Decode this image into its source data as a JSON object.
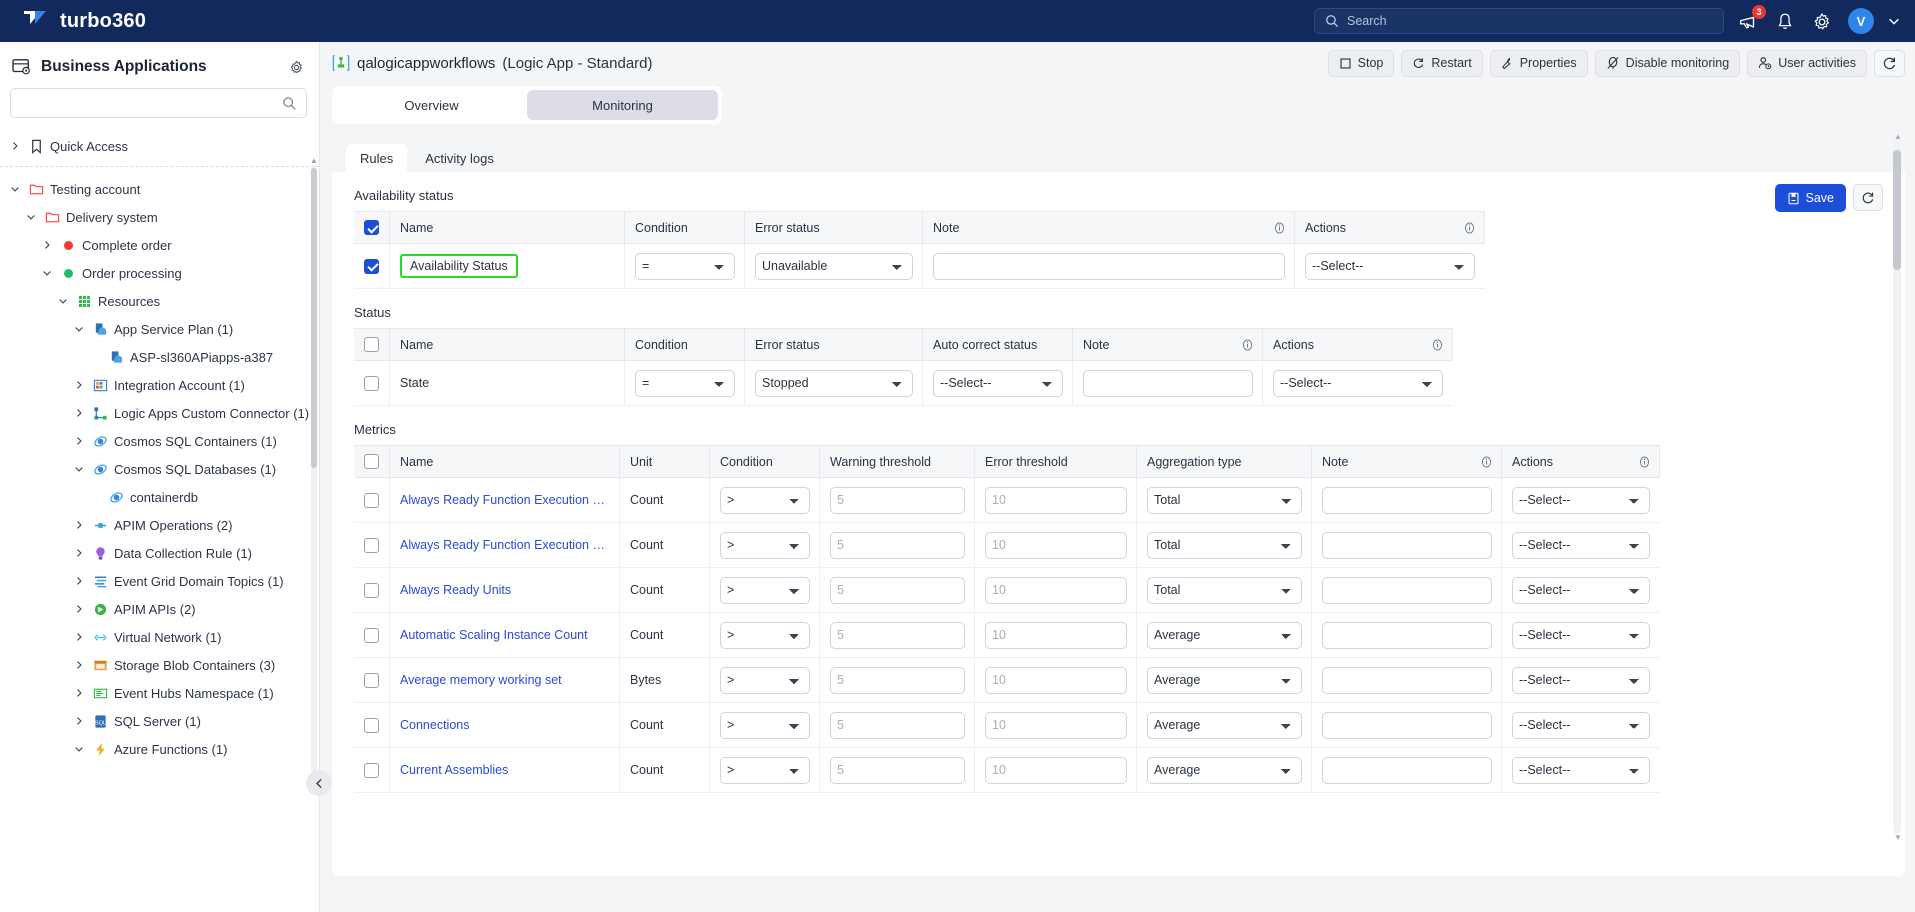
{
  "topbar": {
    "brand": "turbo360",
    "search_placeholder": "Search",
    "notification_badge": "3",
    "avatar_initial": "V",
    "icons": [
      "megaphone-icon",
      "bell-icon",
      "gear-icon",
      "chevron-down-icon"
    ]
  },
  "sidebar": {
    "title": "Business Applications",
    "search_placeholder": "",
    "tree": [
      {
        "label": "Quick Access",
        "indent": 0,
        "caret": "right",
        "icon": "bookmark"
      },
      {
        "label": "Testing account",
        "indent": 0,
        "caret": "down",
        "icon": "folder-red"
      },
      {
        "label": "Delivery system",
        "indent": 1,
        "caret": "down",
        "icon": "folder-red"
      },
      {
        "label": "Complete order",
        "indent": 2,
        "caret": "right",
        "icon": "dot-red"
      },
      {
        "label": "Order processing",
        "indent": 2,
        "caret": "down",
        "icon": "dot-green"
      },
      {
        "label": "Resources",
        "indent": 3,
        "caret": "down",
        "icon": "grid-green"
      },
      {
        "label": "App Service Plan (1)",
        "indent": 4,
        "caret": "down",
        "icon": "appservice"
      },
      {
        "label": "ASP-sl360APiapps-a387",
        "indent": 5,
        "caret": "none",
        "icon": "appservice"
      },
      {
        "label": "Integration Account (1)",
        "indent": 4,
        "caret": "right",
        "icon": "integration"
      },
      {
        "label": "Logic Apps Custom Connector (1)",
        "indent": 4,
        "caret": "right",
        "icon": "connector"
      },
      {
        "label": "Cosmos SQL Containers (1)",
        "indent": 4,
        "caret": "right",
        "icon": "cosmos"
      },
      {
        "label": "Cosmos SQL Databases (1)",
        "indent": 4,
        "caret": "down",
        "icon": "cosmos"
      },
      {
        "label": "containerdb",
        "indent": 5,
        "caret": "none",
        "icon": "cosmos"
      },
      {
        "label": "APIM Operations (2)",
        "indent": 4,
        "caret": "right",
        "icon": "apim-op"
      },
      {
        "label": "Data Collection Rule (1)",
        "indent": 4,
        "caret": "right",
        "icon": "dcr"
      },
      {
        "label": "Event Grid Domain Topics (1)",
        "indent": 4,
        "caret": "right",
        "icon": "eventgrid"
      },
      {
        "label": "APIM APIs (2)",
        "indent": 4,
        "caret": "right",
        "icon": "apim-api"
      },
      {
        "label": "Virtual Network (1)",
        "indent": 4,
        "caret": "right",
        "icon": "vnet"
      },
      {
        "label": "Storage Blob Containers (3)",
        "indent": 4,
        "caret": "right",
        "icon": "blob"
      },
      {
        "label": "Event Hubs Namespace (1)",
        "indent": 4,
        "caret": "right",
        "icon": "eventhub"
      },
      {
        "label": "SQL Server (1)",
        "indent": 4,
        "caret": "right",
        "icon": "sqlserver"
      },
      {
        "label": "Azure Functions (1)",
        "indent": 4,
        "caret": "down",
        "icon": "function"
      }
    ]
  },
  "main": {
    "resource_name": "qalogicappworkflows",
    "resource_type": "(Logic App - Standard)",
    "actions": [
      {
        "label": "Stop",
        "icon": "stop-icon"
      },
      {
        "label": "Restart",
        "icon": "restart-icon"
      },
      {
        "label": "Properties",
        "icon": "wrench-icon"
      },
      {
        "label": "Disable monitoring",
        "icon": "monitor-off-icon"
      },
      {
        "label": "User activities",
        "icon": "user-activity-icon"
      }
    ],
    "refresh_icon": "refresh-icon",
    "tabs": [
      {
        "label": "Overview",
        "active": false
      },
      {
        "label": "Monitoring",
        "active": true
      }
    ],
    "subtabs": [
      {
        "label": "Rules",
        "active": true
      },
      {
        "label": "Activity logs",
        "active": false
      }
    ],
    "save_label": "Save",
    "save_icon": "save-icon",
    "panel_refresh_icon": "refresh-icon"
  },
  "availability": {
    "section_title": "Availability status",
    "header_checked": true,
    "columns": [
      "Name",
      "Condition",
      "Error status",
      "Note",
      "Actions"
    ],
    "info_columns": [
      "Note",
      "Actions"
    ],
    "rows": [
      {
        "checked": true,
        "name": "Availability Status",
        "name_highlighted": true,
        "condition": "=",
        "error_status": "Unavailable",
        "note": "",
        "action": "--Select--"
      }
    ]
  },
  "status": {
    "section_title": "Status",
    "header_checked": false,
    "columns": [
      "Name",
      "Condition",
      "Error status",
      "Auto correct status",
      "Note",
      "Actions"
    ],
    "rows": [
      {
        "checked": false,
        "name": "State",
        "condition": "=",
        "error_status": "Stopped",
        "auto_correct": "--Select--",
        "note": "",
        "action": "--Select--"
      }
    ]
  },
  "metrics": {
    "section_title": "Metrics",
    "header_checked": false,
    "columns": [
      "Name",
      "Unit",
      "Condition",
      "Warning threshold",
      "Error threshold",
      "Aggregation type",
      "Note",
      "Actions"
    ],
    "warning_placeholder": "5",
    "error_placeholder": "10",
    "rows": [
      {
        "checked": false,
        "name": "Always Ready Function Execution …",
        "unit": "Count",
        "condition": ">",
        "warning": "",
        "error": "",
        "aggregation": "Total",
        "note": "",
        "action": "--Select--"
      },
      {
        "checked": false,
        "name": "Always Ready Function Execution …",
        "unit": "Count",
        "condition": ">",
        "warning": "",
        "error": "",
        "aggregation": "Total",
        "note": "",
        "action": "--Select--"
      },
      {
        "checked": false,
        "name": "Always Ready Units",
        "unit": "Count",
        "condition": ">",
        "warning": "",
        "error": "",
        "aggregation": "Total",
        "note": "",
        "action": "--Select--"
      },
      {
        "checked": false,
        "name": "Automatic Scaling Instance Count",
        "unit": "Count",
        "condition": ">",
        "warning": "",
        "error": "",
        "aggregation": "Average",
        "note": "",
        "action": "--Select--"
      },
      {
        "checked": false,
        "name": "Average memory working set",
        "unit": "Bytes",
        "condition": ">",
        "warning": "",
        "error": "",
        "aggregation": "Average",
        "note": "",
        "action": "--Select--"
      },
      {
        "checked": false,
        "name": "Connections",
        "unit": "Count",
        "condition": ">",
        "warning": "",
        "error": "",
        "aggregation": "Average",
        "note": "",
        "action": "--Select--"
      },
      {
        "checked": false,
        "name": "Current Assemblies",
        "unit": "Count",
        "condition": ">",
        "warning": "",
        "error": "",
        "aggregation": "Average",
        "note": "",
        "action": "--Select--"
      }
    ]
  },
  "colors": {
    "topbar": "#11295c",
    "accent": "#1c4ed8",
    "link": "#2b4ad6",
    "highlight": "#22dd22",
    "badge": "#e53935",
    "avatar": "#2f86e8"
  }
}
